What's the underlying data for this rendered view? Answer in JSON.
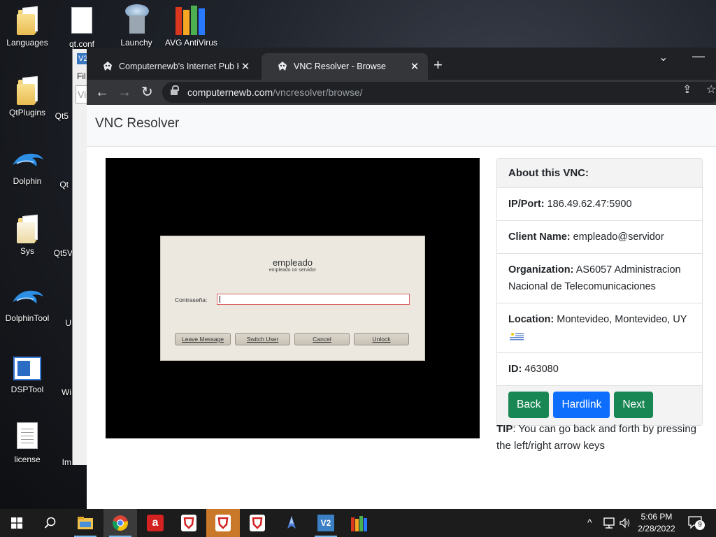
{
  "desktop": {
    "icons": [
      {
        "label": "Languages"
      },
      {
        "label": "QtPlugins"
      },
      {
        "label": "Dolphin"
      },
      {
        "label": "Sys"
      },
      {
        "label": "DolphinTool"
      },
      {
        "label": "DSPTool"
      },
      {
        "label": "license"
      }
    ],
    "column2_labels": [
      "qt.conf",
      "Qt5",
      "Qt",
      "Qt5V",
      "U",
      "Wi",
      "Im"
    ],
    "top_row_labels": [
      "Launchy",
      "AVG AntiVirus"
    ],
    "bg_window_texts": [
      "V2",
      "Fil",
      "Vi"
    ]
  },
  "browser": {
    "tabs": [
      {
        "title": "Computernewb's Internet Pub Hu"
      },
      {
        "title": "VNC Resolver - Browse"
      }
    ],
    "url_host": "computernewb.com",
    "url_path": "/vncresolver/browse/"
  },
  "page": {
    "title": "VNC Resolver",
    "vnc_dialog": {
      "username": "empleado",
      "subtitle": "empleado on servidor",
      "password_label": "Contraseña:",
      "buttons": [
        "Leave Message",
        "Switch User",
        "Cancel",
        "Unlock"
      ]
    },
    "card": {
      "header": "About this VNC:",
      "ip_label": "IP/Port:",
      "ip_value": "186.49.62.47:5900",
      "client_label": "Client Name:",
      "client_value": "empleado@servidor",
      "org_label": "Organization:",
      "org_value": "AS6057 Administracion Nacional de Telecomunicaciones",
      "location_label": "Location:",
      "location_value": "Montevideo, Montevideo, UY",
      "id_label": "ID:",
      "id_value": "463080",
      "buttons": {
        "back": "Back",
        "hardlink": "Hardlink",
        "next": "Next"
      }
    },
    "tip": {
      "label": "TIP",
      "text": ": You can go back and forth by pressing the left/right arrow keys"
    }
  },
  "taskbar": {
    "time": "5:06 PM",
    "date": "2/28/2022",
    "notification_count": "9"
  },
  "colors": {
    "btn_green": "#198754",
    "btn_blue": "#0d6efd",
    "chrome_dark": "#202124",
    "chrome_tab": "#35363a"
  }
}
